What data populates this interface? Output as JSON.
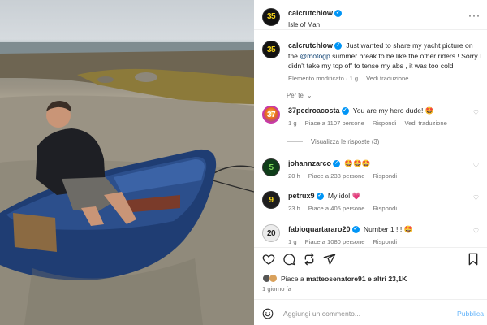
{
  "post": {
    "author": "calcrutchlow",
    "avatar_text": "35",
    "location": "Isle of Man",
    "more_icon": "more-horizontal-icon"
  },
  "caption": {
    "username": "calcrutchlow",
    "text_before_mention": "Just wanted to share my yacht picture on the",
    "mention": "@motogp",
    "text_after_mention": "summer break to be like the other riders ! Sorry I didn't take my top off to tense my abs , it was too cold",
    "edited": "Elemento modificato",
    "time": "1 g",
    "translate": "Vedi traduzione"
  },
  "see_more": "Per te",
  "comments": [
    {
      "username": "37pedroacosta",
      "verified": true,
      "avatar_text": "37",
      "text": "You are my hero dude! 🤩",
      "time": "1 g",
      "likes": "Piace a 1107 persone",
      "reply": "Rispondi",
      "translate": "Vedi traduzione"
    },
    {
      "username": "johannzarco",
      "verified": true,
      "avatar_text": "5",
      "text": "🤩🤩🤩",
      "time": "20 h",
      "likes": "Piace a 238 persone",
      "reply": "Rispondi"
    },
    {
      "username": "petrux9",
      "verified": true,
      "avatar_text": "9",
      "text": "My idol 💗",
      "time": "23 h",
      "likes": "Piace a 405 persone",
      "reply": "Rispondi"
    },
    {
      "username": "fabioquartararo20",
      "verified": true,
      "avatar_text": "20",
      "text": "Number 1 !!! 🤩",
      "time": "1 g",
      "likes": "Piace a 1080 persone",
      "reply": "Rispondi"
    }
  ],
  "view_replies": "Visualizza le risposte (3)",
  "likes": {
    "prefix": "Piace a",
    "user": "matteosenatore91",
    "suffix": "e altri",
    "count": "23,1K"
  },
  "posted_ago": "1 giorno fa",
  "add_comment": {
    "placeholder": "Aggiungi un commento...",
    "post_label": "Pubblica"
  },
  "colors": {
    "verified": "#0095f6",
    "mention": "#00376b",
    "post_button": "#67b5fa",
    "meta_text": "#737373"
  }
}
